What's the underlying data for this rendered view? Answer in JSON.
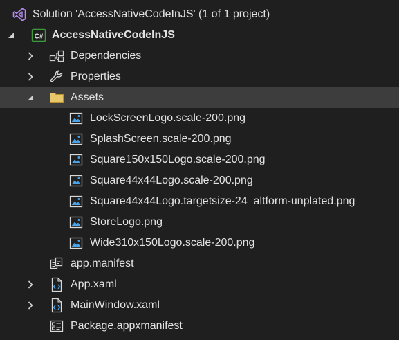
{
  "solution": {
    "label": "Solution 'AccessNativeCodeInJS' (1 of 1 project)"
  },
  "project": {
    "label": "AccessNativeCodeInJS",
    "icon": "csharp-project-icon"
  },
  "nodes": {
    "dependencies": "Dependencies",
    "properties": "Properties",
    "assets": "Assets"
  },
  "assets": [
    "LockScreenLogo.scale-200.png",
    "SplashScreen.scale-200.png",
    "Square150x150Logo.scale-200.png",
    "Square44x44Logo.scale-200.png",
    "Square44x44Logo.targetsize-24_altform-unplated.png",
    "StoreLogo.png",
    "Wide310x150Logo.scale-200.png"
  ],
  "files": {
    "app_manifest": "app.manifest",
    "app_xaml": "App.xaml",
    "mainwindow_xaml": "MainWindow.xaml",
    "package_manifest": "Package.appxmanifest"
  },
  "colors": {
    "background": "#1f1f1f",
    "selected_row": "#3d3d3d",
    "text": "#e2e2e2",
    "vs_purple": "#b48cf0",
    "csharp_green": "#3c9a3c",
    "folder": "#d7b25a",
    "image_blue": "#4aa3e8"
  }
}
